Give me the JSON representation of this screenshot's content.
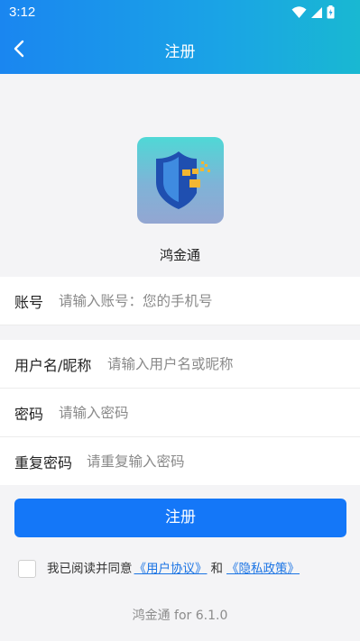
{
  "status_bar": {
    "time": "3:12"
  },
  "nav": {
    "title": "注册"
  },
  "app": {
    "name": "鸿金通"
  },
  "form": {
    "account": {
      "label": "账号",
      "placeholder": "请输入账号：您的手机号"
    },
    "username": {
      "label": "用户名/昵称",
      "placeholder": "请输入用户名或昵称"
    },
    "password": {
      "label": "密码",
      "placeholder": "请输入密码"
    },
    "confirm_password": {
      "label": "重复密码",
      "placeholder": "请重复输入密码"
    }
  },
  "register_button": "注册",
  "agreement": {
    "prefix": "我已阅读并同意",
    "user_agreement": "《用户协议》",
    "and": "和",
    "privacy_policy": "《隐私政策》",
    "checked": false
  },
  "version": "鸿金通 for 6.1.0",
  "colors": {
    "primary": "#1477f8",
    "header_start": "#1a86f0",
    "header_end": "#19b8d2",
    "link": "#1b74e4"
  }
}
